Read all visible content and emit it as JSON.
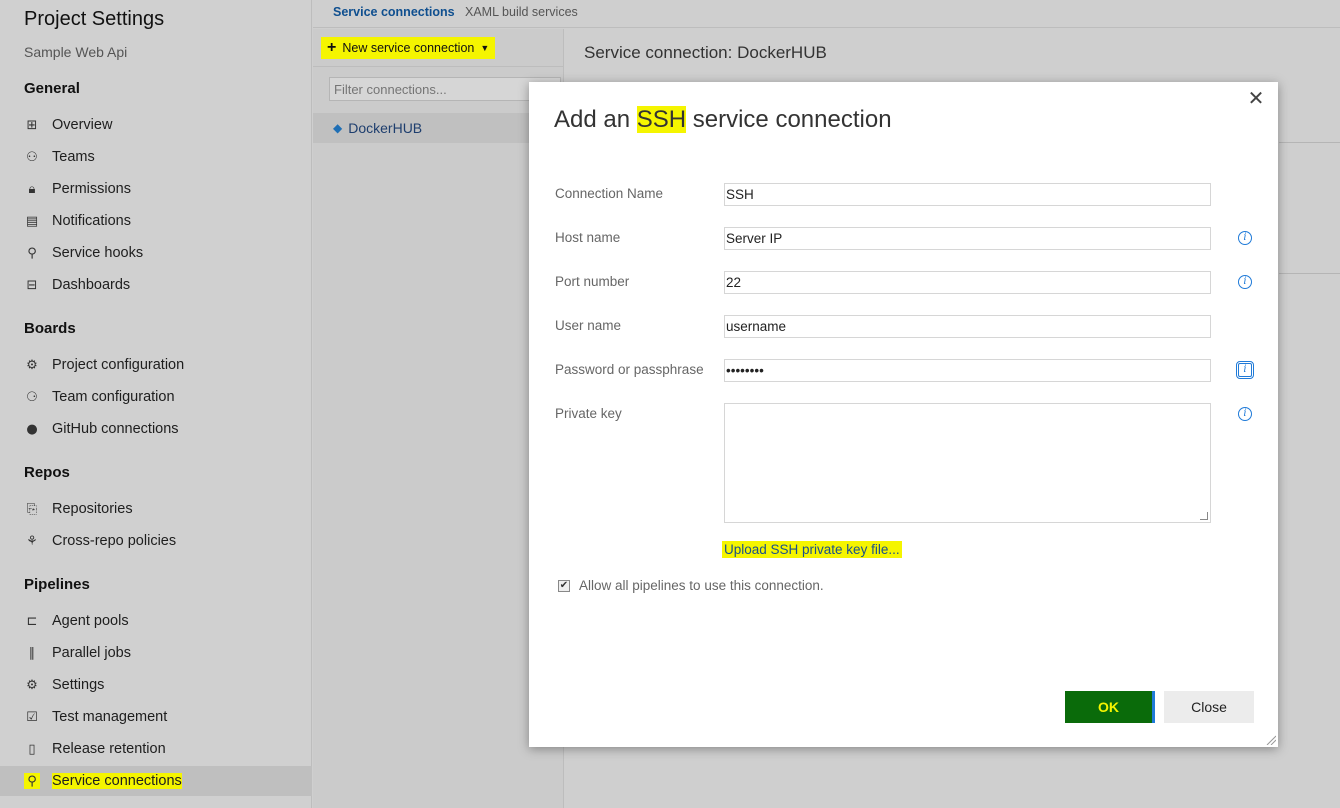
{
  "sidebar": {
    "title": "Project Settings",
    "subtitle": "Sample Web Api",
    "sections": {
      "general": "General",
      "boards": "Boards",
      "repos": "Repos",
      "pipelines": "Pipelines"
    },
    "items": {
      "overview": "Overview",
      "teams": "Teams",
      "permissions": "Permissions",
      "notifications": "Notifications",
      "service_hooks": "Service hooks",
      "dashboards": "Dashboards",
      "project_configuration": "Project configuration",
      "team_configuration": "Team configuration",
      "github_connections": "GitHub connections",
      "repositories": "Repositories",
      "cross_repo_policies": "Cross-repo policies",
      "agent_pools": "Agent pools",
      "parallel_jobs": "Parallel jobs",
      "settings": "Settings",
      "test_management": "Test management",
      "release_retention": "Release retention",
      "service_connections": "Service connections"
    }
  },
  "tabs": {
    "service_connections": "Service connections",
    "xaml_build_services": "XAML build services"
  },
  "middle": {
    "new_connection_label": "New service connection",
    "filter_placeholder": "Filter connections...",
    "connection_item": "DockerHUB"
  },
  "right": {
    "title": "Service connection: DockerHUB"
  },
  "dialog": {
    "title_prefix": "Add an ",
    "title_highlight": "SSH",
    "title_suffix": " service connection",
    "fields": {
      "connection_name_label": "Connection Name",
      "connection_name_value": "SSH",
      "host_name_label": "Host name",
      "host_name_value": "Server IP",
      "port_label": "Port number",
      "port_value": "22",
      "user_label": "User name",
      "user_value": "username",
      "password_label": "Password or passphrase",
      "password_value": "password",
      "private_key_label": "Private key"
    },
    "upload_link": "Upload SSH private key file...",
    "allow_all_label": "Allow all pipelines to use this connection.",
    "ok_label": "OK",
    "close_label": "Close"
  },
  "colors": {
    "highlight": "#f5f500",
    "ok_button": "#0a6b0a",
    "accent": "#1f7ad8"
  }
}
